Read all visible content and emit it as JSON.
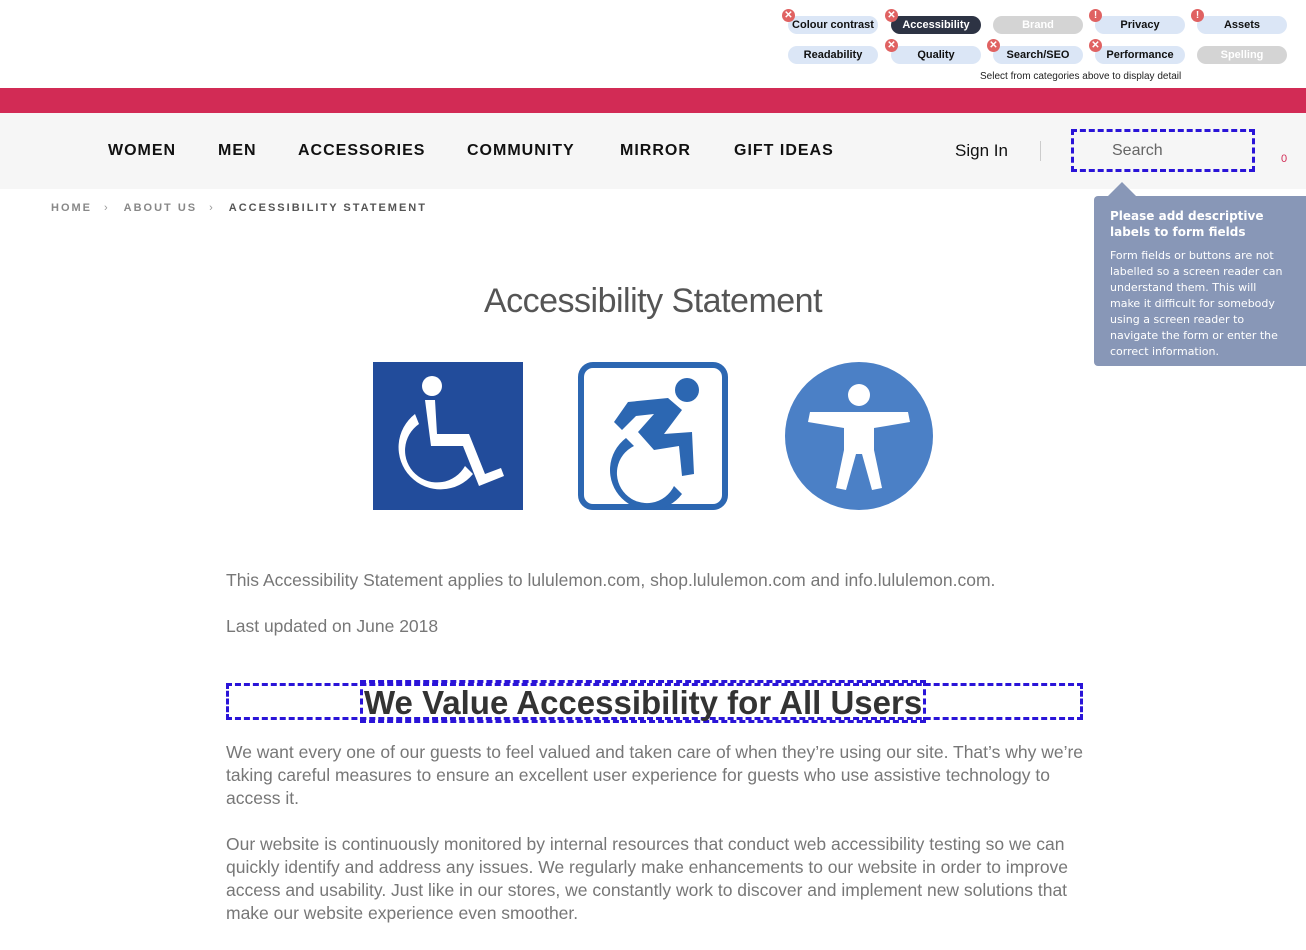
{
  "checker": {
    "categories": [
      {
        "label": "Colour contrast",
        "state": "normal",
        "badge": "error"
      },
      {
        "label": "Accessibility",
        "state": "active",
        "badge": "error"
      },
      {
        "label": "Brand",
        "state": "disabled",
        "badge": ""
      },
      {
        "label": "Privacy",
        "state": "normal",
        "badge": "warning"
      },
      {
        "label": "Assets",
        "state": "normal",
        "badge": "warning"
      },
      {
        "label": "Readability",
        "state": "normal",
        "badge": ""
      },
      {
        "label": "Quality",
        "state": "normal",
        "badge": "error"
      },
      {
        "label": "Search/SEO",
        "state": "normal",
        "badge": "error"
      },
      {
        "label": "Performance",
        "state": "normal",
        "badge": "error"
      },
      {
        "label": "Spelling",
        "state": "disabled",
        "badge": ""
      }
    ],
    "hint": "Select from categories above to display detail",
    "colors": {
      "pill": "#dbe6f6",
      "active": "#2d3344",
      "badge": "#e06262"
    }
  },
  "promo_bar": {
    "color": "#d22b55"
  },
  "nav": {
    "items": [
      "WOMEN",
      "MEN",
      "ACCESSORIES",
      "COMMUNITY",
      "MIRROR",
      "GIFT IDEAS"
    ],
    "sign_in": "Sign In",
    "search_placeholder": "Search",
    "cart_count": "0"
  },
  "breadcrumb": {
    "items": [
      "HOME",
      "ABOUT US"
    ],
    "current": "ACCESSIBILITY STATEMENT"
  },
  "tooltip": {
    "title": "Please add descriptive labels to form fields",
    "body": "Form fields or buttons are not labelled so a screen reader can understand them. This will make it difficult for somebody using a screen reader to navigate the form or enter the correct information."
  },
  "content": {
    "title": "Accessibility Statement",
    "icons": [
      "wheelchair-icon",
      "dynamic-wheelchair-icon",
      "accessibility-person-icon"
    ],
    "intro": "This Accessibility Statement applies to lululemon.com, shop.lululemon.com and info.lululemon.com.",
    "updated": "Last updated on June 2018",
    "heading": "We Value Accessibility for All Users",
    "para1": "We want every one of our guests to feel valued and taken care of when they’re using our site. That’s why we’re taking careful measures to ensure an excellent user experience for guests who use assistive technology to access it.",
    "para2": "Our website is continuously monitored by internal resources that conduct web accessibility testing so we can quickly identify and address any issues. We regularly make enhancements to our website in order to improve access and usability. Just like in our stores, we constantly work to discover and implement new solutions that make our website experience even smoother."
  }
}
